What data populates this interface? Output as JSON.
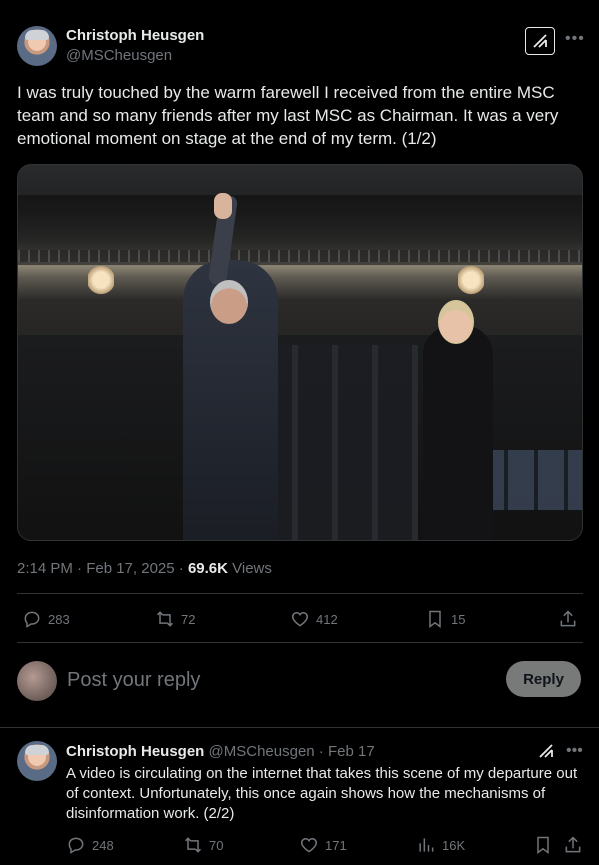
{
  "tweet": {
    "author_name": "Christoph Heusgen",
    "author_handle": "@MSCheusgen",
    "text": "I was truly touched by the warm farewell I received from the entire MSC team and so many friends after my last MSC as Chairman. It was a very emotional moment on stage at the end of my term. (1/2)",
    "timestamp": "2:14 PM · Feb 17, 2025 · ",
    "views_count": "69.6K",
    "views_label": " Views",
    "stats": {
      "replies": "283",
      "reposts": "72",
      "likes": "412",
      "bookmarks": "15"
    },
    "icons": [
      "grok-icon",
      "more-icon",
      "reply-icon",
      "repost-icon",
      "like-icon",
      "bookmark-icon",
      "share-icon"
    ]
  },
  "reply_box": {
    "placeholder": "Post your reply",
    "button_label": "Reply"
  },
  "thread_reply": {
    "author_name": "Christoph Heusgen",
    "author_handle": "@MSCheusgen",
    "date": " · Feb 17",
    "text": "A video is circulating on the internet that takes this scene of my departure out of context. Unfortunately, this once again shows how the mechanisms of disinformation work. (2/2)",
    "stats": {
      "replies": "248",
      "reposts": "70",
      "likes": "171",
      "views": "16K"
    }
  },
  "colors": {
    "background": "#000000",
    "text": "#e7e9ea",
    "muted": "#71767b",
    "border": "#2f3336",
    "reply_button": "#787a7a"
  }
}
